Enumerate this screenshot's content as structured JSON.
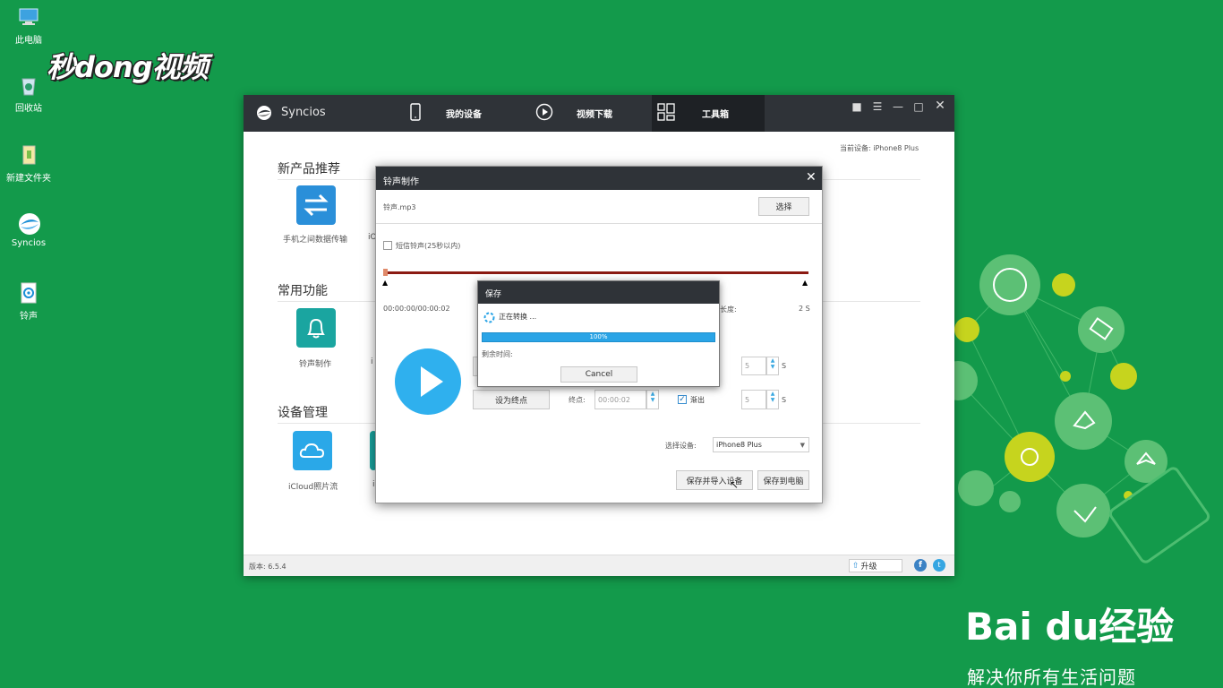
{
  "desktop": {
    "icons": [
      {
        "label": "此电脑",
        "icon": "computer-icon"
      },
      {
        "label": "回收站",
        "icon": "recycle-bin-icon"
      },
      {
        "label": "新建文件夹",
        "icon": "folder-icon"
      },
      {
        "label": "Syncios",
        "icon": "syncios-app-icon"
      },
      {
        "label": "铃声",
        "icon": "ringtone-file-icon"
      }
    ],
    "watermark_top": "秒dong视频",
    "watermark_brand": "Bai du经验",
    "watermark_tagline": "解决你所有生活问题"
  },
  "window": {
    "app_name": "Syncios",
    "tabs": [
      {
        "label": "我的设备",
        "icon": "phone-icon"
      },
      {
        "label": "视频下载",
        "icon": "play-circle-icon"
      },
      {
        "label": "工具箱",
        "icon": "grid-icon"
      }
    ],
    "active_tab": "工具箱",
    "current_device": "当前设备: iPhone8 Plus",
    "sections": {
      "new_products": {
        "title": "新产品推荐",
        "items": [
          {
            "label": "手机之间数据传输"
          },
          {
            "label": "iO"
          }
        ]
      },
      "common": {
        "title": "常用功能",
        "items": [
          {
            "label": "铃声制作"
          },
          {
            "label": "i"
          }
        ]
      },
      "device_mgmt": {
        "title": "设备管理",
        "items": [
          {
            "label": "iCloud照片流"
          },
          {
            "label": "i"
          }
        ]
      }
    },
    "version": "版本: 6.5.4",
    "upgrade_label": "升级",
    "colors": {
      "titlebar": "#2f3338",
      "accent": "#2aa4e6",
      "tile_teal": "#1aa5a0",
      "desktop": "#139a4b"
    }
  },
  "ringtone_dialog": {
    "title": "铃声制作",
    "file_name": "铃声.mp3",
    "choose_label": "选择",
    "sms_checkbox_label": "短信铃声(25秒以内)",
    "sms_checked": false,
    "time_display": "00:00:00/00:00:02",
    "length_label": "长度:",
    "length_value": "2 S",
    "set_end_label": "设为终点",
    "end_label": "终点:",
    "end_value": "00:00:02",
    "fade_out_label": "渐出",
    "fade_out_checked": true,
    "fade_in_value": "5",
    "fade_out_value": "5",
    "seconds_unit": "S",
    "select_device_label": "选择设备:",
    "device_option": "iPhone8 Plus",
    "save_import_label": "保存并导入设备",
    "save_pc_label": "保存到电脑"
  },
  "save_modal": {
    "title": "保存",
    "status": "正在转换 ...",
    "progress_text": "100%",
    "progress": 1.0,
    "remaining_label": "剩余时间:",
    "cancel_label": "Cancel"
  }
}
